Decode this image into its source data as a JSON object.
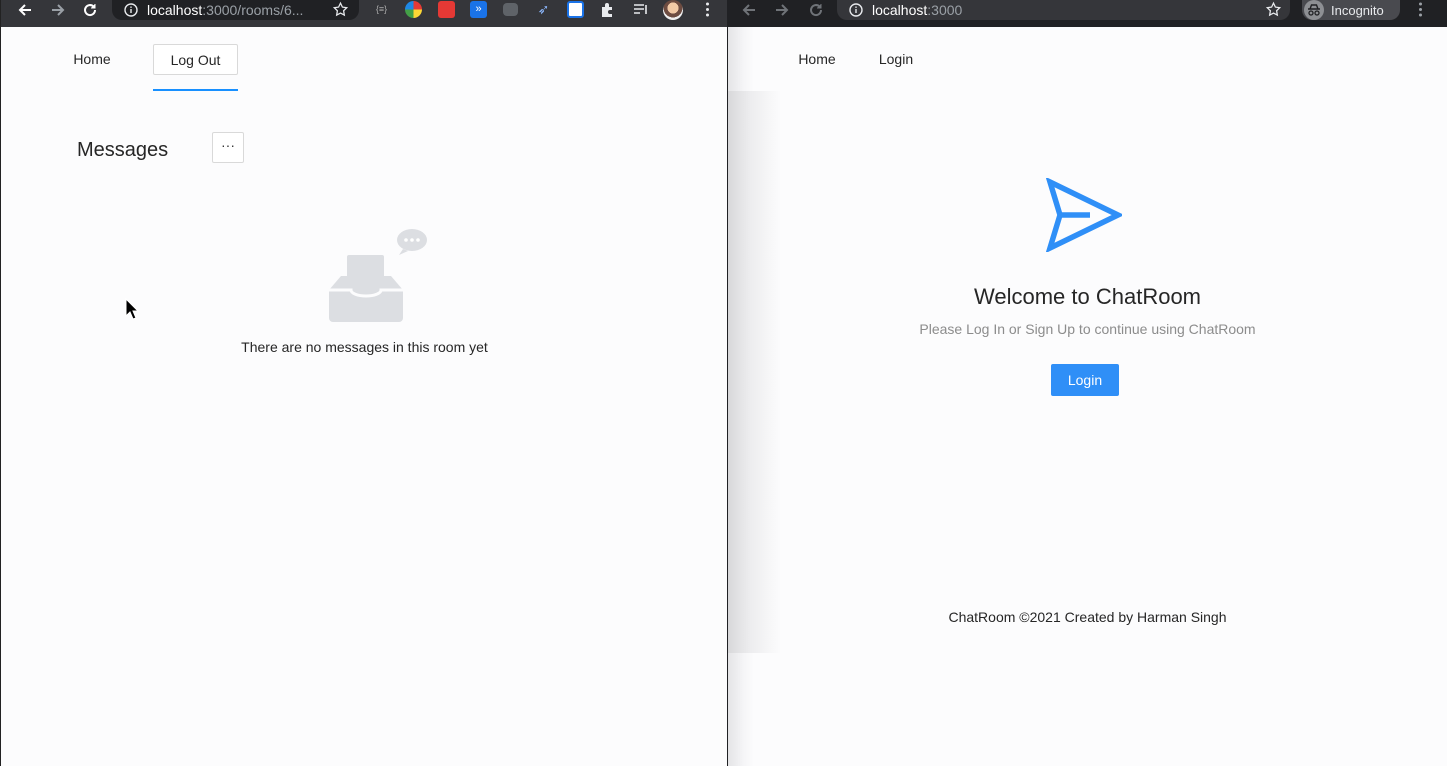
{
  "left_window": {
    "address_bar": {
      "host": "localhost",
      "rest": ":3000/rooms/6..."
    },
    "nav": {
      "home": "Home",
      "logout": "Log Out"
    },
    "page": {
      "title": "Messages",
      "more_button": "···",
      "empty_text": "There are no messages in this room yet"
    }
  },
  "right_window": {
    "address_bar": {
      "host": "localhost",
      "rest": ":3000"
    },
    "incognito_label": "Incognito",
    "nav": {
      "home": "Home",
      "login": "Login"
    },
    "page": {
      "welcome": "Welcome to ChatRoom",
      "subtitle": "Please Log In or Sign Up to continue using ChatRoom",
      "login_button": "Login",
      "footer": "ChatRoom ©2021 Created by Harman Singh"
    }
  },
  "colors": {
    "primary": "#1890ff",
    "login_button": "#2f8ff7",
    "chrome_toolbar": "#35363a",
    "omnibox": "#202124"
  },
  "icons": [
    "back-arrow-icon",
    "forward-arrow-icon",
    "reload-icon",
    "info-icon",
    "star-icon",
    "extension-icon",
    "puzzle-icon",
    "reading-list-icon",
    "avatar",
    "kebab-menu-icon",
    "incognito-icon",
    "send-plane-icon",
    "inbox-icon",
    "chat-bubble-icon",
    "mouse-cursor-icon"
  ]
}
